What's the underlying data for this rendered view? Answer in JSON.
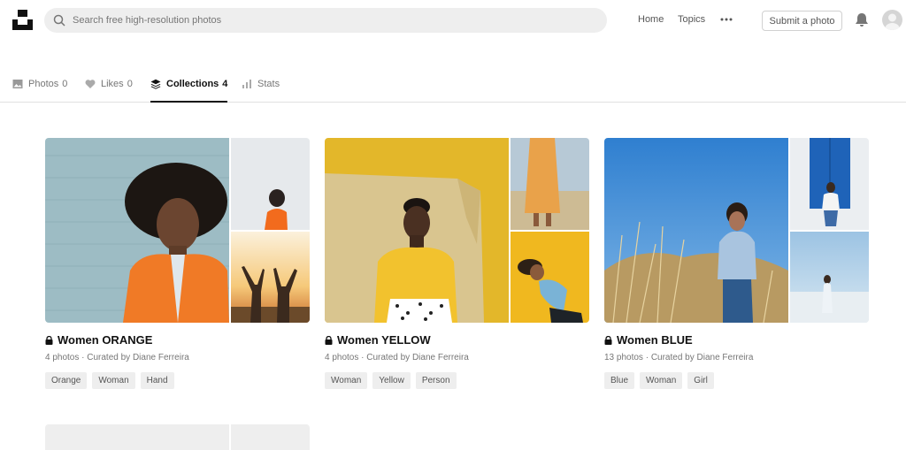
{
  "search": {
    "placeholder": "Search free high-resolution photos"
  },
  "nav": {
    "home": "Home",
    "topics": "Topics",
    "submit": "Submit a photo"
  },
  "tabs": [
    {
      "label": "Photos",
      "count": "0",
      "icon": "image-icon"
    },
    {
      "label": "Likes",
      "count": "0",
      "icon": "heart-icon"
    },
    {
      "label": "Collections",
      "count": "4",
      "icon": "layers-icon",
      "active": true
    },
    {
      "label": "Stats",
      "count": "",
      "icon": "bar-chart-icon"
    }
  ],
  "collections": [
    {
      "title": "Women ORANGE",
      "meta": "4 photos · Curated by Diane Ferreira",
      "tags": [
        "Orange",
        "Woman",
        "Hand"
      ],
      "accent": "#f26b1d"
    },
    {
      "title": "Women YELLOW",
      "meta": "4 photos · Curated by Diane Ferreira",
      "tags": [
        "Woman",
        "Yellow",
        "Person"
      ],
      "accent": "#e8b923"
    },
    {
      "title": "Women BLUE",
      "meta": "13 photos · Curated by Diane Ferreira",
      "tags": [
        "Blue",
        "Woman",
        "Girl"
      ],
      "accent": "#3a7fd5"
    }
  ],
  "colors": {
    "brand": "#111111",
    "muted": "#767676",
    "chip": "#eeeeee"
  }
}
